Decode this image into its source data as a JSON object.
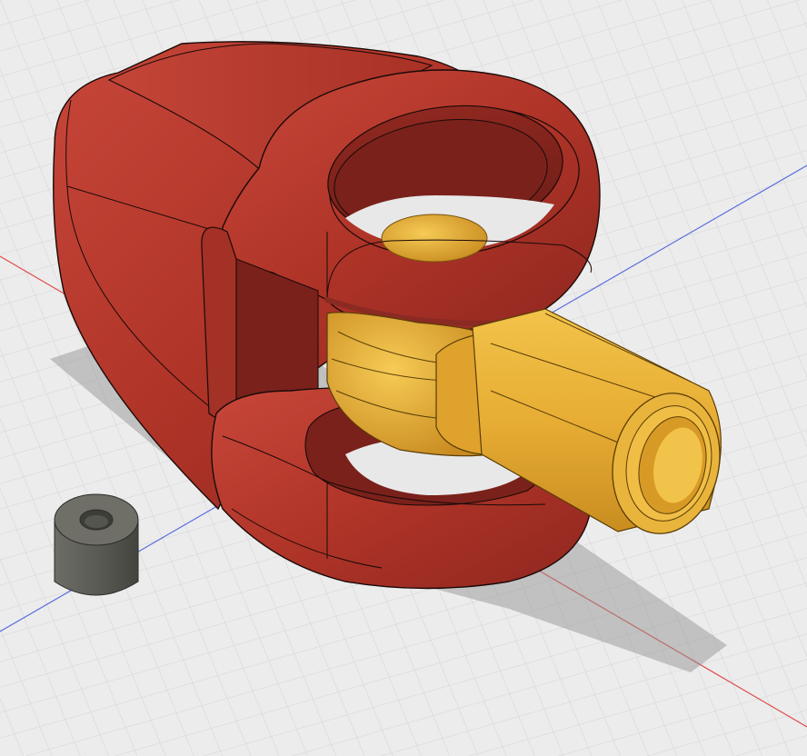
{
  "app": {
    "title": "",
    "view": "3d-cad-viewport"
  },
  "scene": {
    "background_color": "#ececec",
    "grid_minor_color": "#d3d3d3",
    "grid_major_color": "#bdbdbd",
    "x_axis_color": "#e05050",
    "y_axis_color": "#5a6fe0",
    "bodies": [
      {
        "name": "clevis-yoke",
        "color": "#b23a2c"
      },
      {
        "name": "ball-joint-rod",
        "color": "#e7ad34"
      },
      {
        "name": "spacer",
        "color": "#5b5b55"
      }
    ]
  }
}
